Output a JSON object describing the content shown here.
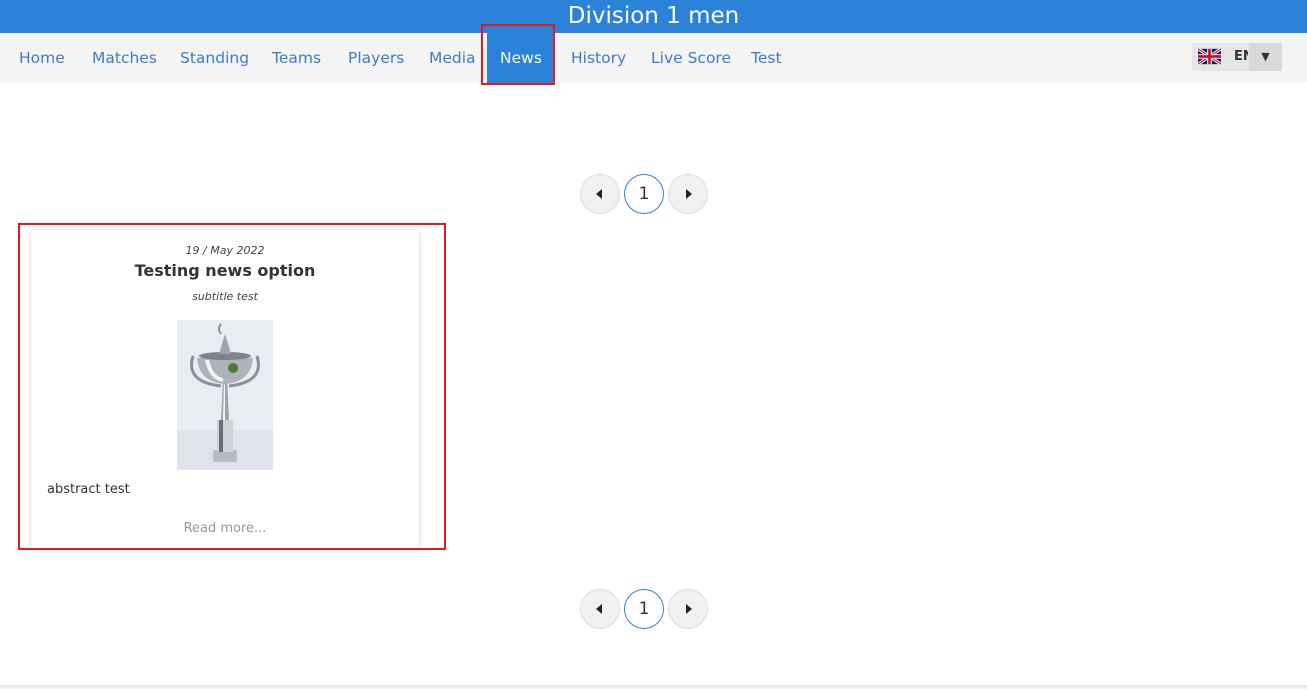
{
  "header": {
    "title": "Division 1 men"
  },
  "nav": {
    "items": [
      {
        "label": "Home"
      },
      {
        "label": "Matches"
      },
      {
        "label": "Standing"
      },
      {
        "label": "Teams"
      },
      {
        "label": "Players"
      },
      {
        "label": "Media"
      },
      {
        "label": "News"
      },
      {
        "label": "History"
      },
      {
        "label": "Live Score"
      },
      {
        "label": "Test"
      }
    ],
    "active": "News"
  },
  "language": {
    "code": "EN",
    "flag_icon": "uk-flag-icon",
    "caret": "▼"
  },
  "pagination": {
    "current_page": "1"
  },
  "news": [
    {
      "date": "19 / May 2022",
      "title": "Testing news option",
      "subtitle": "subtitle test",
      "image_icon": "trophy-photo",
      "abstract": "abstract test",
      "read_more": "Read more..."
    }
  ],
  "colors": {
    "primary": "#2b82d9",
    "nav_text": "#3d7dc6",
    "highlight": "#e41b1b"
  }
}
